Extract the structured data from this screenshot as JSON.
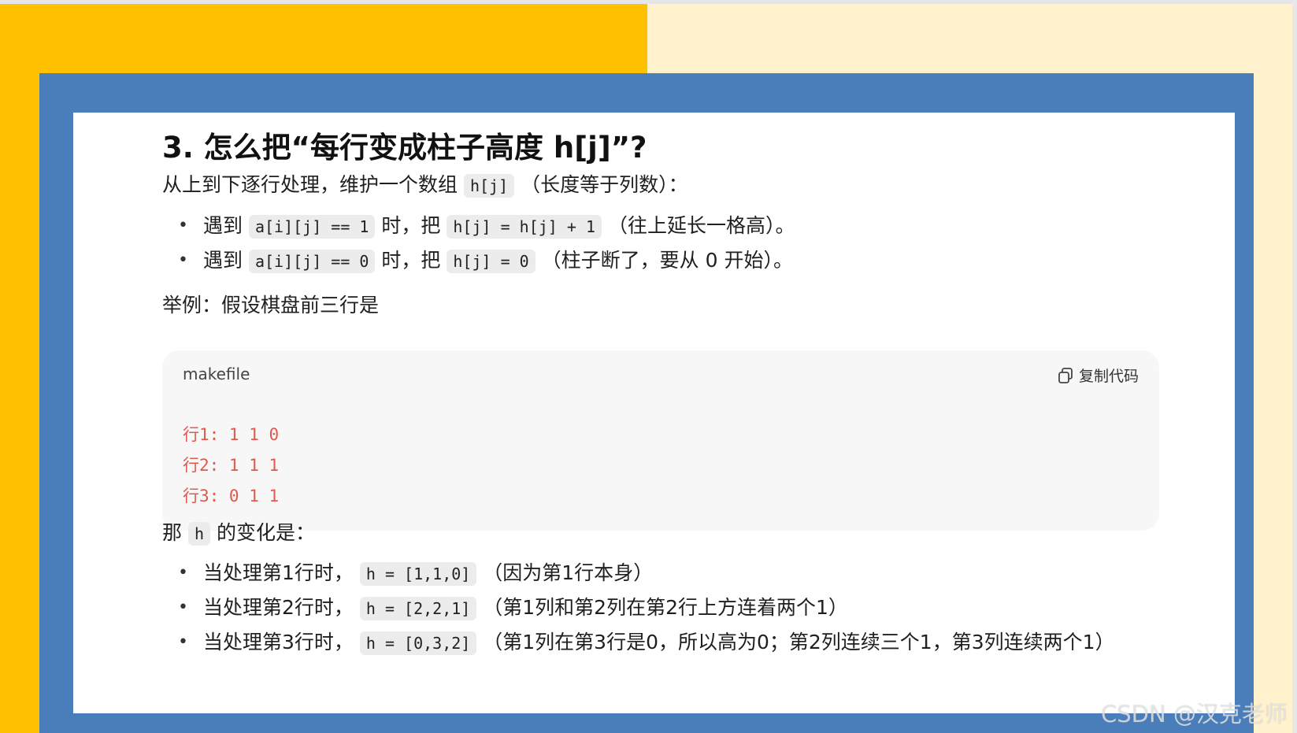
{
  "heading": "3. 怎么把“每行变成柱子高度 h[j]”?",
  "intro": {
    "text_before": "从上到下逐行处理，维护一个数组",
    "code": "h[j]",
    "text_after": "（长度等于列数）："
  },
  "rules": [
    {
      "prefix": "遇到",
      "code1": "a[i][j] == 1",
      "mid": "时，把",
      "code2": "h[j] = h[j] + 1",
      "suffix": "（往上延长一格高）。"
    },
    {
      "prefix": "遇到",
      "code1": "a[i][j] == 0",
      "mid": "时，把",
      "code2": "h[j] = 0",
      "suffix": "（柱子断了，要从 0 开始）。"
    }
  ],
  "example_intro": "举例：假设棋盘前三行是",
  "code_block": {
    "language": "makefile",
    "copy_label": "复制代码",
    "lines": [
      "行1: 1 1 0",
      "行2: 1 1 1",
      "行3: 0 1 1"
    ]
  },
  "change_intro": {
    "text_before": "那",
    "code": "h",
    "text_after": "的变化是："
  },
  "changes": [
    {
      "prefix": "当处理第1行时，",
      "code": "h = [1,1,0]",
      "suffix": "（因为第1行本身）"
    },
    {
      "prefix": "当处理第2行时，",
      "code": "h = [2,2,1]",
      "suffix": "（第1列和第2列在第2行上方连着两个1）"
    },
    {
      "prefix": "当处理第3行时，",
      "code": "h = [0,3,2]",
      "suffix": "（第1列在第3行是0，所以高为0；第2列连续三个1，第3列连续两个1）"
    }
  ],
  "watermark": "CSDN @汉克老师",
  "colors": {
    "yellow": "#ffc000",
    "cream": "#fff2cc",
    "frame_blue": "#4a7ebb",
    "code_text": "#e05a4b"
  }
}
